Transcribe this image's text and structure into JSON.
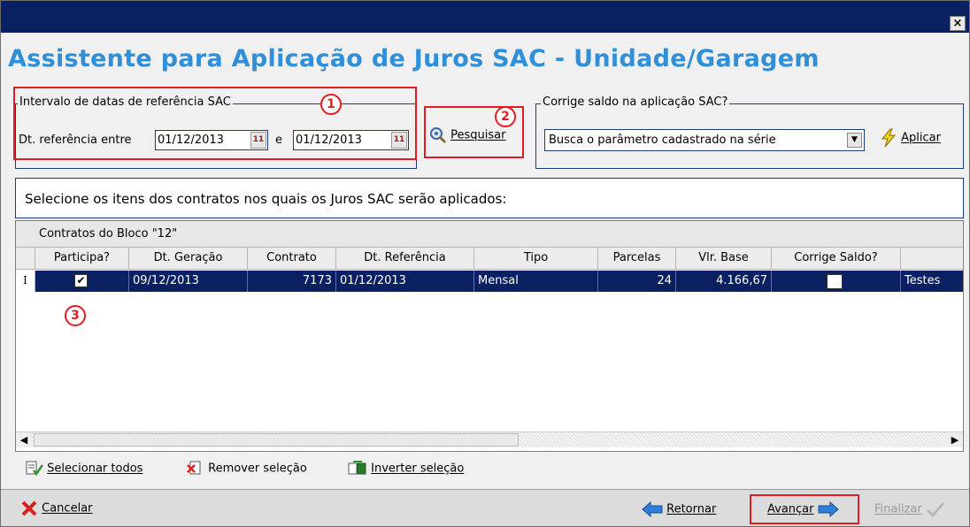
{
  "window": {
    "close_glyph": "×"
  },
  "heading": "Assistente para Aplicação de Juros SAC - Unidade/Garagem",
  "interval": {
    "legend": "Intervalo de datas de referência SAC",
    "label": "Dt. referência entre",
    "date_from": "01/12/2013",
    "joiner": "e",
    "date_to": "01/12/2013",
    "cal_glyph": "11"
  },
  "search": {
    "label": "Pesquisar",
    "icon": "magnifier-icon"
  },
  "corrige": {
    "legend": "Corrige saldo na aplicação SAC?",
    "selected": "Busca o parâmetro cadastrado na série",
    "apply_label": "Aplicar",
    "apply_icon": "lightning-icon"
  },
  "markers": [
    "1",
    "2",
    "3"
  ],
  "prompt": "Selecione os itens dos contratos nos quais os Juros SAC serão aplicados:",
  "grid": {
    "band_title": "Contratos do Bloco \"12\"",
    "columns": [
      "Participa?",
      "Dt. Geração",
      "Contrato",
      "Dt. Referência",
      "Tipo",
      "Parcelas",
      "Vlr. Base",
      "Corrige Saldo?"
    ],
    "row_indicator": "I",
    "rows": [
      {
        "participa": true,
        "dt_geracao": "09/12/2013",
        "contrato": "7173",
        "dt_referencia": "01/12/2013",
        "tipo": "Mensal",
        "parcelas": "24",
        "vlr_base": "4.166,67",
        "corrige_saldo": false,
        "extra": "Testes"
      }
    ]
  },
  "selection_actions": {
    "select_all": "Selecionar todos",
    "remove": "Remover seleção",
    "invert": "Inverter seleção"
  },
  "footer": {
    "cancel": "Cancelar",
    "back": "Retornar",
    "next": "Avançar",
    "finish": "Finalizar"
  },
  "colors": {
    "title_bar": "#0a2061",
    "heading": "#2f8fd8",
    "highlight": "#e51a22",
    "selected_row": "#0a2061"
  }
}
